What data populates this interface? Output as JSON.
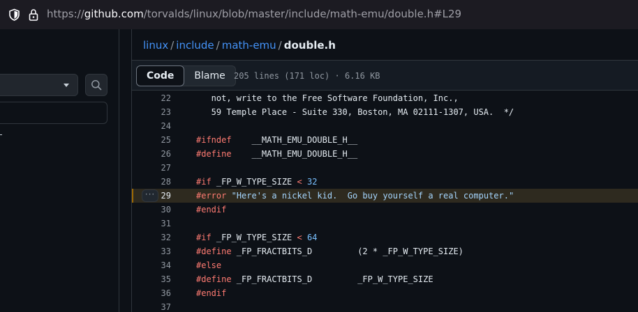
{
  "browser": {
    "url_prefix": "https://",
    "url_host": "github.com",
    "url_path": "/torvalds/linux/blob/master/include/math-emu/double.h#L29"
  },
  "sidebar": {
    "filter_placeholder": ""
  },
  "breadcrumb": {
    "items": [
      "linux",
      "include",
      "math-emu"
    ],
    "separator": "/",
    "current": "double.h"
  },
  "file_header": {
    "tabs": [
      "Code",
      "Blame"
    ],
    "active_tab": "Code",
    "stats": "205 lines (171 loc) · 6.16 KB"
  },
  "code": {
    "highlighted_line": 29,
    "lines": [
      {
        "n": "22",
        "text": "   not, write to the Free Software Foundation, Inc.,"
      },
      {
        "n": "23",
        "text": "   59 Temple Place - Suite 330, Boston, MA 02111-1307, USA.  */"
      },
      {
        "n": "24",
        "text": ""
      },
      {
        "n": "25",
        "text": "#ifndef    __MATH_EMU_DOUBLE_H__"
      },
      {
        "n": "26",
        "text": "#define    __MATH_EMU_DOUBLE_H__"
      },
      {
        "n": "27",
        "text": ""
      },
      {
        "n": "28",
        "text": "#if _FP_W_TYPE_SIZE < 32"
      },
      {
        "n": "29",
        "text": "#error \"Here's a nickel kid.  Go buy yourself a real computer.\""
      },
      {
        "n": "30",
        "text": "#endif"
      },
      {
        "n": "31",
        "text": ""
      },
      {
        "n": "32",
        "text": "#if _FP_W_TYPE_SIZE < 64"
      },
      {
        "n": "33",
        "text": "#define _FP_FRACTBITS_D         (2 * _FP_W_TYPE_SIZE)"
      },
      {
        "n": "34",
        "text": "#else"
      },
      {
        "n": "35",
        "text": "#define _FP_FRACTBITS_D         _FP_W_TYPE_SIZE"
      },
      {
        "n": "36",
        "text": "#endif"
      },
      {
        "n": "37",
        "text": ""
      }
    ]
  },
  "colors": {
    "background": "#0d1117",
    "link": "#4493f8",
    "keyword": "#ff7b72",
    "number": "#79c0ff",
    "string": "#a5d6ff",
    "highlight": "#2e2a1f"
  },
  "icons": [
    "shield-icon",
    "lock-icon",
    "search-icon",
    "chevron-down-icon",
    "kebab-icon"
  ]
}
